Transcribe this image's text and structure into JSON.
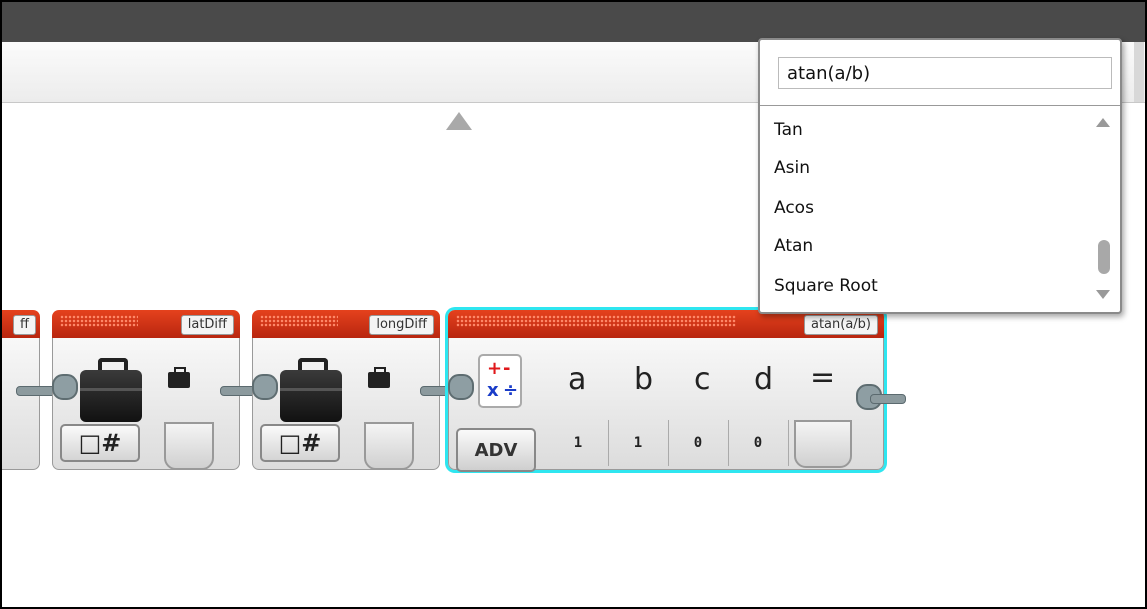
{
  "dropdown": {
    "input_value": "atan(a/b)",
    "items": [
      "Tan",
      "Asin",
      "Acos",
      "Atan",
      "Square Root"
    ]
  },
  "blocks": {
    "partial_label": "ff",
    "lat_label": "latDiff",
    "long_label": "longDiff",
    "math_label": "atan(a/b)",
    "mode_icon_text": "□#",
    "adv_label": "ADV",
    "params": {
      "letters": [
        "a",
        "b",
        "c",
        "d"
      ],
      "equals": "=",
      "values": [
        "1",
        "1",
        "0",
        "0"
      ]
    },
    "math_ops": [
      "+",
      "-",
      "x",
      "÷"
    ]
  }
}
